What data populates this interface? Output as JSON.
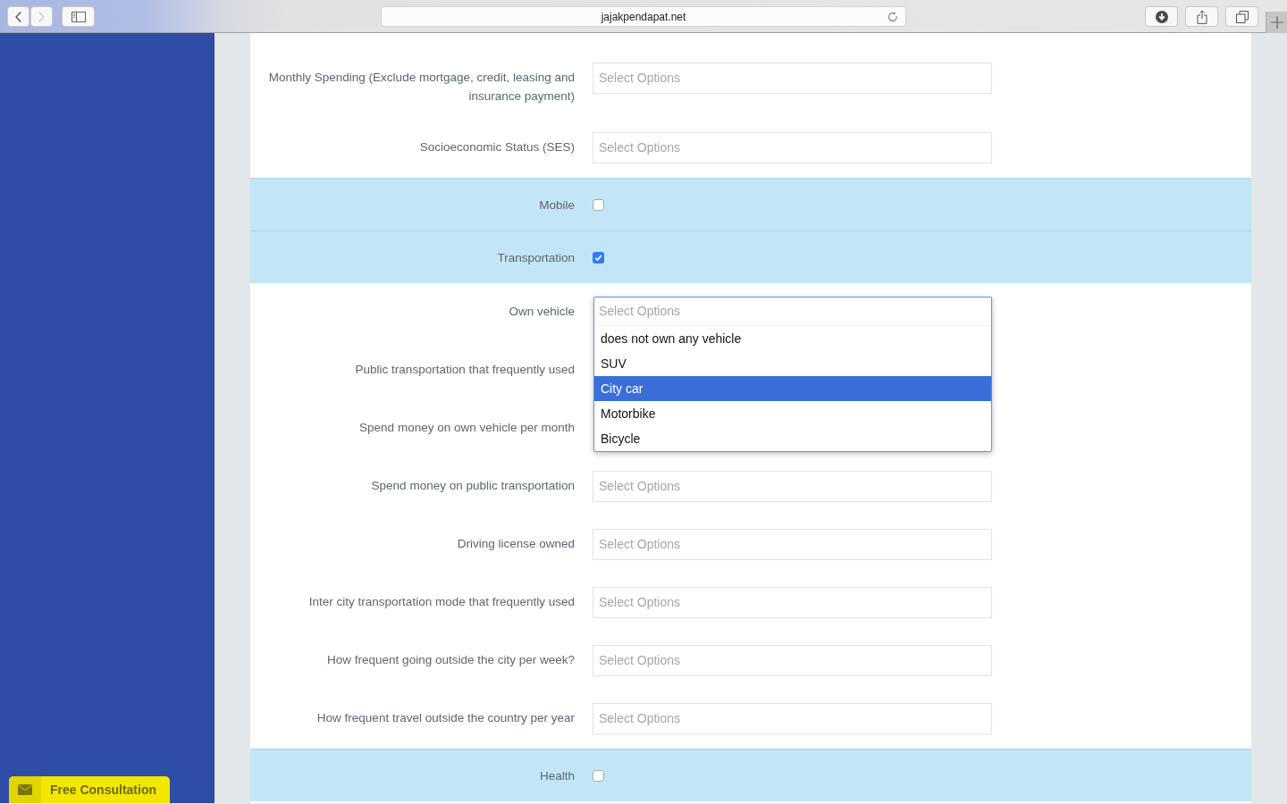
{
  "browser": {
    "nav_buttons": [
      {
        "kind": "back",
        "disabled": false
      },
      {
        "kind": "forward",
        "disabled": true
      }
    ],
    "url": "jajakpendapat.net"
  },
  "sidebar": {
    "cta_label": "Free Consultation"
  },
  "form": {
    "sections": [
      {
        "kind": "fields",
        "rows": [
          {
            "label": "Monthly Spending (Exclude mortgage, credit, leasing and insurance payment)",
            "placeholder": "Select Options",
            "expanded": false
          },
          {
            "label": "Socioeconomic Status (SES)",
            "placeholder": "Select Options",
            "expanded": false
          }
        ]
      },
      {
        "kind": "toggle",
        "label": "Mobile",
        "checked": false
      },
      {
        "kind": "toggle",
        "label": "Transportation",
        "checked": true
      },
      {
        "kind": "fields",
        "rows": [
          {
            "label": "Own vehicle",
            "placeholder": "Select Options",
            "expanded": true,
            "options": [
              {
                "label": "does not own any vehicle",
                "selected": false
              },
              {
                "label": "SUV",
                "selected": false
              },
              {
                "label": "City car",
                "selected": true
              },
              {
                "label": "Motorbike",
                "selected": false
              },
              {
                "label": "Bicycle",
                "selected": false
              }
            ]
          },
          {
            "label": "Public transportation that frequently used"
          },
          {
            "label": "Spend money on own vehicle per month"
          },
          {
            "label": "Spend money on public transportation",
            "placeholder": "Select Options",
            "expanded": false
          },
          {
            "label": "Driving license owned",
            "placeholder": "Select Options",
            "expanded": false
          },
          {
            "label": "Inter city transportation mode that frequently used",
            "placeholder": "Select Options",
            "expanded": false
          },
          {
            "label": "How frequent going outside the city per week?",
            "placeholder": "Select Options",
            "expanded": false
          },
          {
            "label": "How frequent travel outside the country per year",
            "placeholder": "Select Options",
            "expanded": false
          }
        ]
      },
      {
        "kind": "toggle",
        "label": "Health",
        "checked": false
      }
    ]
  }
}
